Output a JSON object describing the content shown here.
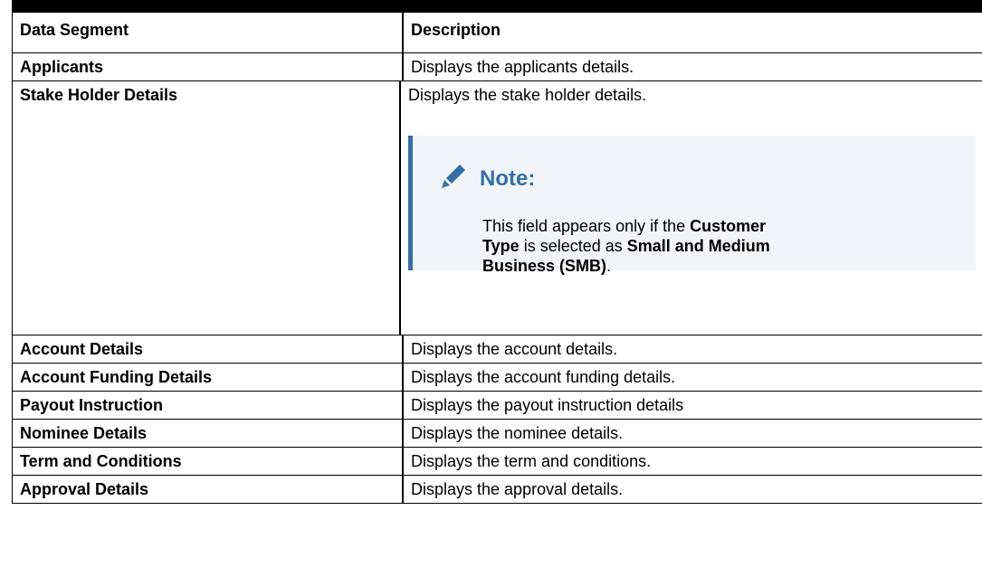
{
  "table": {
    "headers": [
      "Data Segment",
      "Description"
    ],
    "rows": [
      {
        "segment": "Applicants",
        "description": "Displays the applicants details."
      },
      {
        "segment": "Stake Holder Details",
        "description": "Displays the stake holder details."
      },
      {
        "segment": "Account Details",
        "description": "Displays the account details."
      },
      {
        "segment": "Account Funding Details",
        "description": "Displays the account funding details."
      },
      {
        "segment": "Payout Instruction",
        "description": "Displays the payout instruction details"
      },
      {
        "segment": "Nominee Details",
        "description": "Displays the nominee details."
      },
      {
        "segment": "Term and Conditions",
        "description": "Displays the term and conditions."
      },
      {
        "segment": "Approval Details",
        "description": "Displays the approval details."
      }
    ]
  },
  "note": {
    "title": "Note:",
    "text_1": "This field appears only if the ",
    "bold_1": "Customer Type",
    "text_2": " is selected as ",
    "bold_2": "Small and Medium Business (SMB)",
    "text_3": "."
  },
  "colors": {
    "note_accent": "#346fa7",
    "note_background": "#f1f4f8"
  },
  "icons": {
    "note_icon": "pencil-icon"
  }
}
